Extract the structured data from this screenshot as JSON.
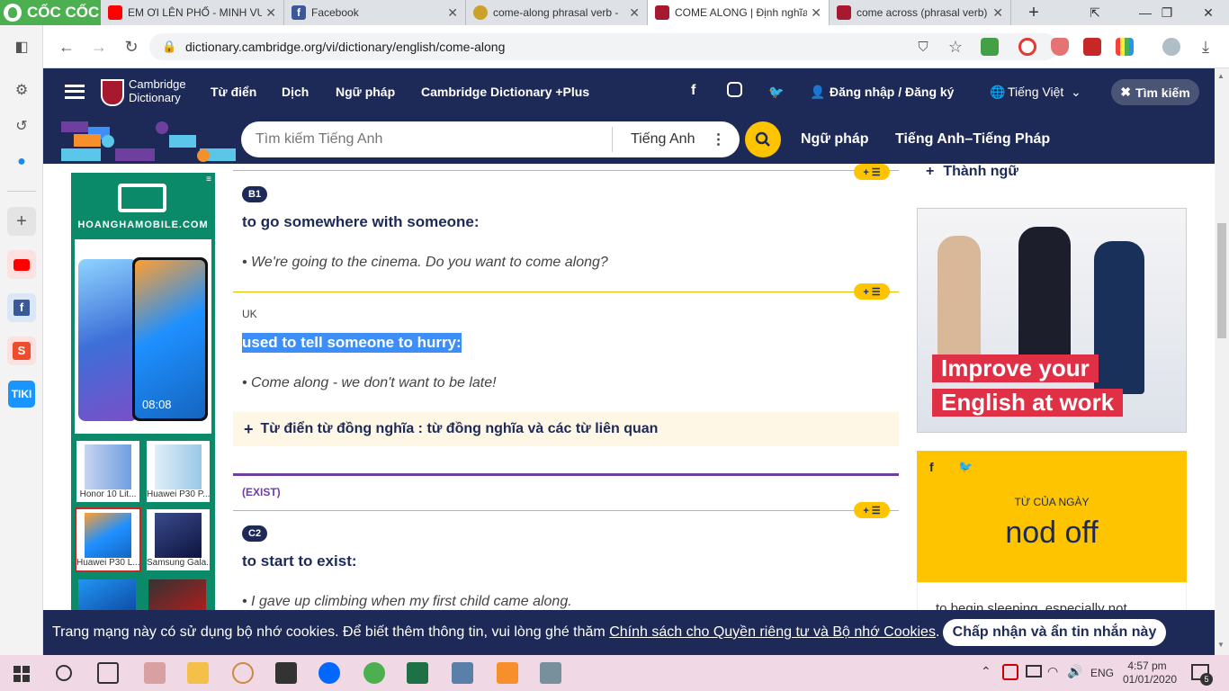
{
  "browser": {
    "brand": "CỐC CỐC",
    "tabs": [
      {
        "title": "EM ƠI LÊN PHỐ - MINH VU",
        "color": "#ff0000"
      },
      {
        "title": "Facebook",
        "color": "#3b5998"
      },
      {
        "title": "come-along phrasal verb - ",
        "color": "#c9a227"
      },
      {
        "title": "COME ALONG | Định nghĩa",
        "color": "#a6192e"
      },
      {
        "title": "come across (phrasal verb)",
        "color": "#a6192e"
      }
    ],
    "new_tab": "+",
    "url": "dictionary.cambridge.org/vi/dictionary/english/come-along"
  },
  "header": {
    "logo_line1": "Cambridge",
    "logo_line2": "Dictionary",
    "nav": [
      "Từ điển",
      "Dịch",
      "Ngữ pháp",
      "Cambridge Dictionary +Plus"
    ],
    "login": "Đăng nhập / Đăng ký",
    "language": "Tiếng Việt",
    "search_button": "Tìm kiếm"
  },
  "search": {
    "placeholder": "Tìm kiếm Tiếng Anh",
    "dictionary": "Tiếng Anh",
    "links": [
      "Ngữ pháp",
      "Tiếng Anh–Tiếng Pháp"
    ]
  },
  "left_ad": {
    "brand": "HOANGHAMOBILE.COM",
    "phone_time": "08:08",
    "products": [
      "Honor 10 Lit...",
      "Huawei P30 P...",
      "Huawei P30 L...",
      "Samsung Gala..."
    ]
  },
  "entry": {
    "senses": [
      {
        "level": "B1",
        "definition": "to go somewhere with someone:",
        "example": "We're going to the cinema. Do you want to come along?"
      },
      {
        "region": "UK",
        "definition": "used to tell someone to hurry:",
        "example": "Come along - we don't want to be late!"
      }
    ],
    "thesaurus": "Từ điển từ đồng nghĩa : từ đồng nghĩa và các từ liên quan",
    "guideword": "(EXIST)",
    "sense3": {
      "level": "C2",
      "definition": "to start to exist:",
      "example": "I gave up climbing when my first child came along."
    },
    "plus_label": "+ ☰"
  },
  "right": {
    "idioms": "Thành ngữ",
    "ad_text_1": "Improve your",
    "ad_text_2": "English at work",
    "wotd_label": "TỪ CỦA NGÀY",
    "wotd_word": "nod off",
    "wotd_def": "to begin sleeping, especially not"
  },
  "cookie": {
    "text": "Trang mạng này có sử dụng bộ nhớ cookies. Để biết thêm thông tin, vui lòng ghé thăm",
    "link": "Chính sách cho Quyền riêng tư và Bộ nhớ Cookies",
    "button": "Chấp nhận và ẩn tin nhắn này"
  },
  "taskbar": {
    "lang": "ENG",
    "time": "4:57 pm",
    "date": "01/01/2020",
    "notifications": "5"
  },
  "colors": {
    "navy": "#1d2a57",
    "yellow": "#fec400",
    "purple": "#6f3fa0",
    "highlight": "#3e8ef7"
  }
}
